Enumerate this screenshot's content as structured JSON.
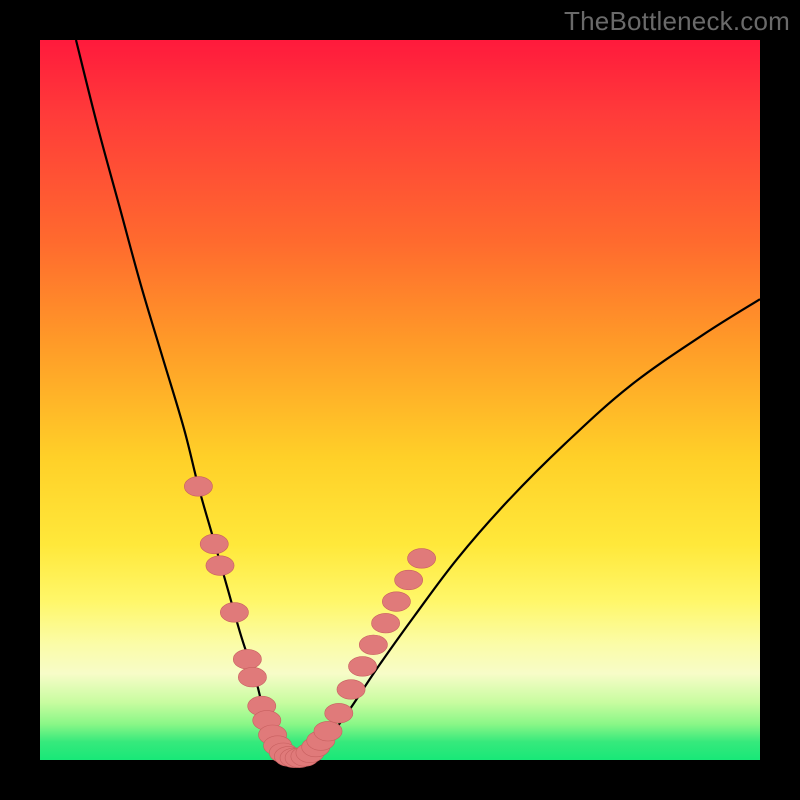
{
  "watermark": "TheBottleneck.com",
  "colors": {
    "background": "#000000",
    "curve": "#000000",
    "marker_fill": "#e07a7a",
    "marker_stroke": "#c86060",
    "gradient_top": "#ff1a3c",
    "gradient_bottom": "#18e878"
  },
  "chart_data": {
    "type": "line",
    "title": "",
    "xlabel": "",
    "ylabel": "",
    "xlim": [
      0,
      100
    ],
    "ylim": [
      0,
      100
    ],
    "grid": false,
    "series": [
      {
        "name": "bottleneck-curve",
        "x": [
          5,
          8,
          11,
          14,
          17,
          20,
          22,
          24,
          26,
          28,
          30,
          31,
          32,
          33.5,
          35,
          36.5,
          38,
          40,
          43,
          47,
          52,
          58,
          65,
          73,
          82,
          92,
          100
        ],
        "y": [
          100,
          88,
          77,
          66,
          56,
          46,
          38,
          31,
          24,
          17,
          11,
          7,
          4,
          1.5,
          0.2,
          0.2,
          1.2,
          3,
          7,
          13,
          20,
          28,
          36,
          44,
          52,
          59,
          64
        ]
      }
    ],
    "markers": [
      {
        "x": 22.0,
        "y": 38.0,
        "r": 1.7
      },
      {
        "x": 24.2,
        "y": 30.0,
        "r": 1.7
      },
      {
        "x": 25.0,
        "y": 27.0,
        "r": 1.7
      },
      {
        "x": 27.0,
        "y": 20.5,
        "r": 1.7
      },
      {
        "x": 28.8,
        "y": 14.0,
        "r": 1.7
      },
      {
        "x": 29.5,
        "y": 11.5,
        "r": 1.7
      },
      {
        "x": 30.8,
        "y": 7.5,
        "r": 1.7
      },
      {
        "x": 31.5,
        "y": 5.5,
        "r": 1.7
      },
      {
        "x": 32.3,
        "y": 3.5,
        "r": 1.7
      },
      {
        "x": 33.0,
        "y": 2.0,
        "r": 1.7
      },
      {
        "x": 33.8,
        "y": 1.0,
        "r": 1.7
      },
      {
        "x": 34.5,
        "y": 0.5,
        "r": 1.7
      },
      {
        "x": 35.3,
        "y": 0.3,
        "r": 1.7
      },
      {
        "x": 36.0,
        "y": 0.3,
        "r": 1.7
      },
      {
        "x": 36.8,
        "y": 0.5,
        "r": 1.7
      },
      {
        "x": 37.5,
        "y": 1.0,
        "r": 1.7
      },
      {
        "x": 38.3,
        "y": 1.8,
        "r": 1.7
      },
      {
        "x": 39.0,
        "y": 2.7,
        "r": 1.7
      },
      {
        "x": 40.0,
        "y": 4.0,
        "r": 1.7
      },
      {
        "x": 41.5,
        "y": 6.5,
        "r": 1.7
      },
      {
        "x": 43.2,
        "y": 9.8,
        "r": 1.7
      },
      {
        "x": 44.8,
        "y": 13.0,
        "r": 1.7
      },
      {
        "x": 46.3,
        "y": 16.0,
        "r": 1.7
      },
      {
        "x": 48.0,
        "y": 19.0,
        "r": 1.7
      },
      {
        "x": 49.5,
        "y": 22.0,
        "r": 1.7
      },
      {
        "x": 51.2,
        "y": 25.0,
        "r": 1.7
      },
      {
        "x": 53.0,
        "y": 28.0,
        "r": 1.7
      }
    ]
  }
}
